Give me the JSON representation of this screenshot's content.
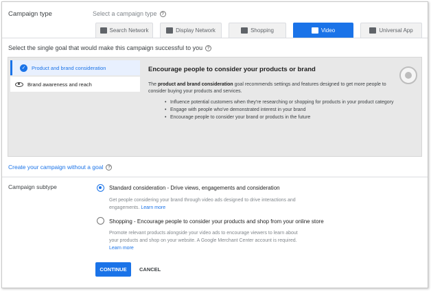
{
  "campaign_type": {
    "label": "Campaign type",
    "hint": "Select a campaign type",
    "tabs": [
      {
        "label": "Search Network",
        "icon": "search-network-icon"
      },
      {
        "label": "Display Network",
        "icon": "display-network-icon"
      },
      {
        "label": "Shopping",
        "icon": "shopping-icon"
      },
      {
        "label": "Video",
        "icon": "video-icon",
        "selected": true
      },
      {
        "label": "Universal App",
        "icon": "universal-app-icon"
      }
    ]
  },
  "goal": {
    "question": "Select the single goal that would make this campaign successful to you",
    "options": [
      {
        "label": "Product and brand consideration",
        "selected": true
      },
      {
        "label": "Brand awareness and reach"
      }
    ],
    "detail": {
      "title": "Encourage people to consider your products or brand",
      "body_prefix": "The ",
      "body_bold": "product and brand consideration",
      "body_suffix": " goal recommends settings and features designed to get more people to consider buying your products and services.",
      "bullets": [
        "Influence potential customers when they're researching or shopping for products in your product category",
        "Engage with people who've demonstrated interest in your brand",
        "Encourage people to consider your brand or products in the future"
      ]
    },
    "no_goal_link": "Create your campaign without a goal"
  },
  "subtype": {
    "label": "Campaign subtype",
    "options": [
      {
        "title": "Standard consideration - Drive views, engagements and consideration",
        "desc": "Get people considering your brand through video ads designed to drive interactions and engagements.",
        "learn_more": "Learn more",
        "selected": true
      },
      {
        "title": "Shopping - Encourage people to consider your products and shop from your online store",
        "desc": "Promote relevant products alongside your video ads to encourage viewers to learn about your products and shop on your website. A Google Merchant Center account is required.",
        "learn_more": "Learn more",
        "selected": false
      }
    ]
  },
  "actions": {
    "continue": "CONTINUE",
    "cancel": "CANCEL"
  },
  "colors": {
    "accent": "#1a73e8",
    "panel_bg": "#e8e8e8"
  }
}
